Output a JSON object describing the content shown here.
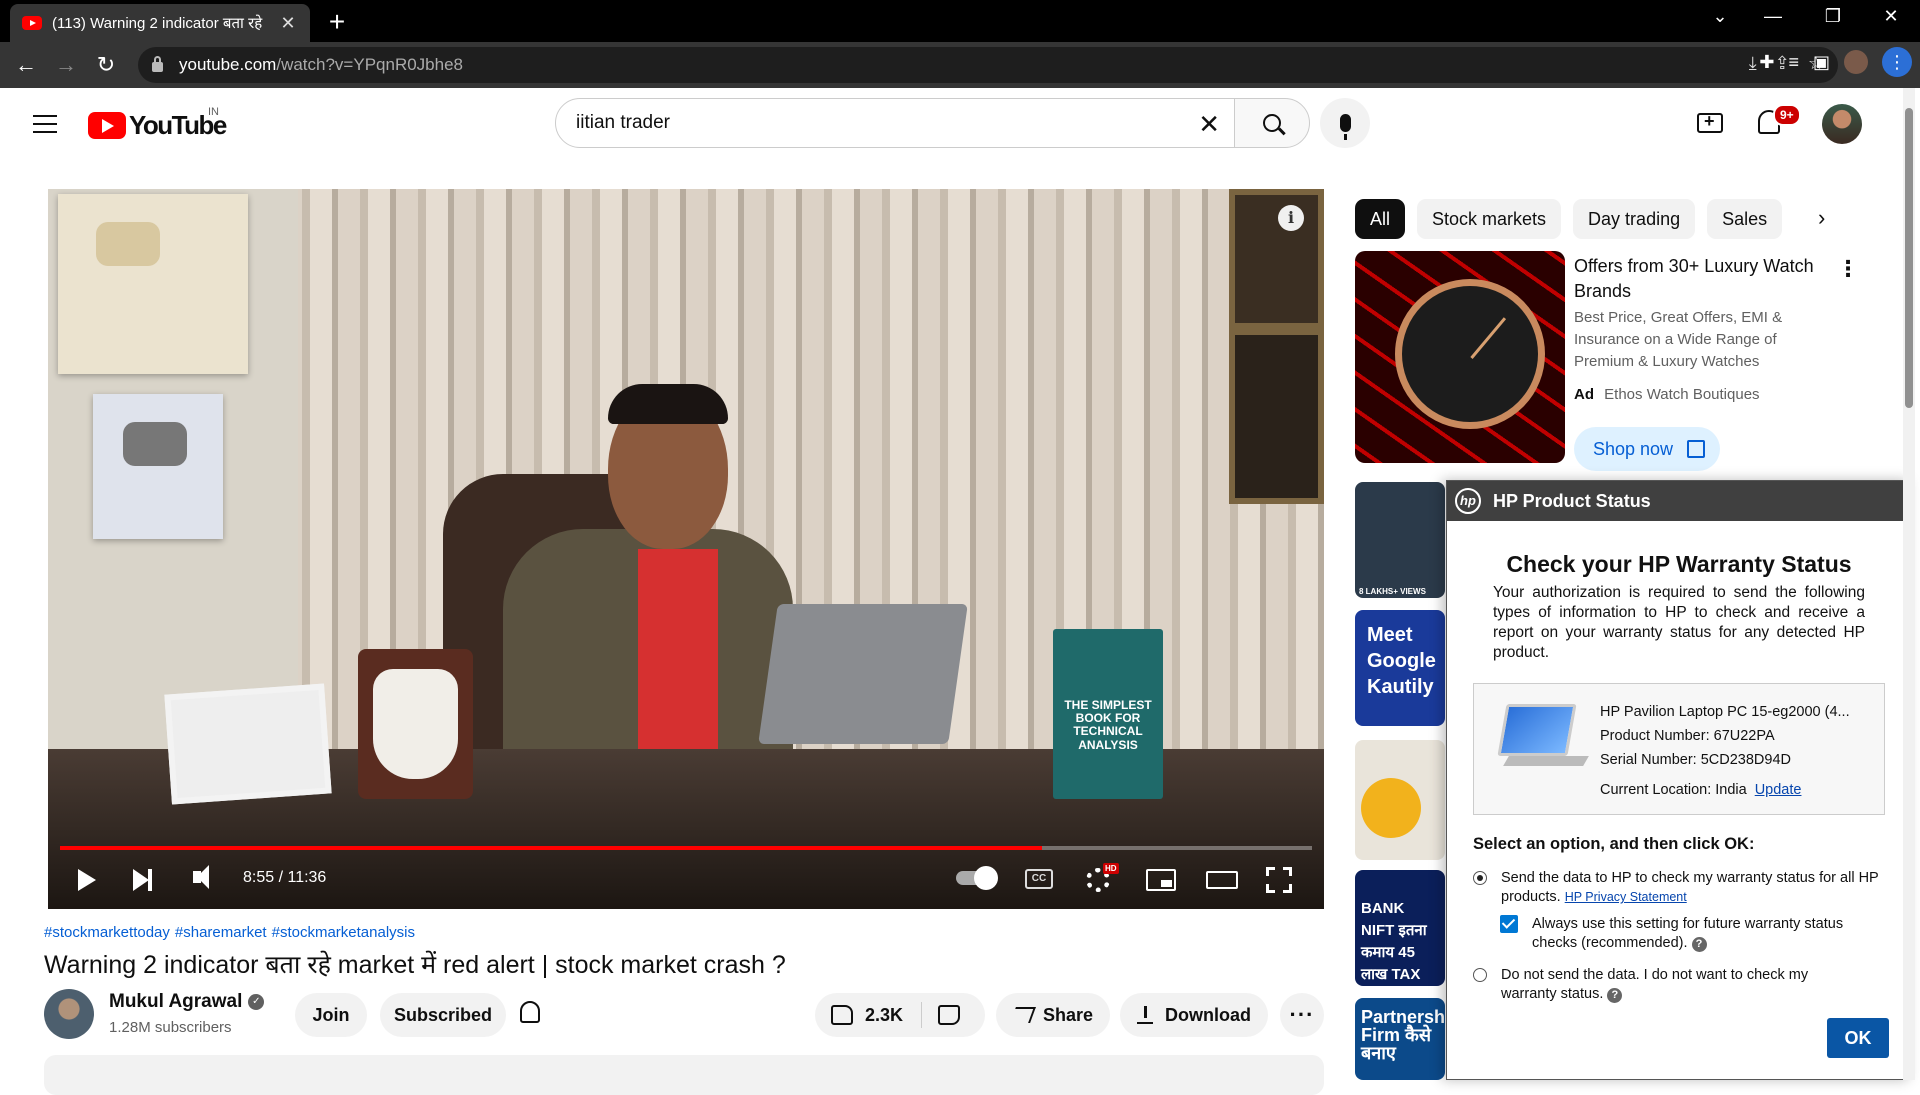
{
  "browser": {
    "tab_title": "(113) Warning 2 indicator बता रहे",
    "tab_close": "✕",
    "new_tab": "+",
    "url_host": "youtube.com",
    "url_path": "/watch?v=YPqnR0Jbhe8",
    "win_controls": [
      "⌄",
      "—",
      "❐",
      "✕"
    ]
  },
  "header": {
    "logo_text": "YouTube",
    "country_code": "IN",
    "search_value": "iitian trader",
    "search_clear": "✕",
    "notification_count": "9+"
  },
  "player": {
    "progress_fraction": 0.784,
    "current_time": "8:55 / 11:36",
    "info_label": "i",
    "cc_label": "CC",
    "hd_label": "HD",
    "book_text": "THE SIMPLEST BOOK FOR TECHNICAL ANALYSIS"
  },
  "video": {
    "hashtags": [
      "#stockmarkettoday",
      "#sharemarket",
      "#stockmarketanalysis"
    ],
    "title": "Warning 2 indicator बता रहे market में red alert | stock market crash ?",
    "channel_name": "Mukul Agrawal",
    "verified_mark": "✓",
    "subscribers": "1.28M subscribers",
    "join_label": "Join",
    "subscribed_label": "Subscribed",
    "likes": "2.3K",
    "share_label": "Share",
    "download_label": "Download",
    "more_label": "···"
  },
  "sidebar": {
    "chips": [
      "All",
      "Stock markets",
      "Day trading",
      "Sales"
    ],
    "chip_next": "›",
    "ad": {
      "title": "Offers from 30+ Luxury Watch Brands",
      "description": "Best Price, Great Offers, EMI & Insurance on a Wide Range of Premium & Luxury Watches",
      "badge": "Ad",
      "advertiser": "Ethos Watch Boutiques",
      "cta": "Shop now",
      "menu": "⋮"
    },
    "rec_thumbs": [
      {
        "text": "8 LAKHS+ VIEWS",
        "bg": "#2b3a4a"
      },
      {
        "text": "Meet Google Kautily",
        "bg": "#1a3a9a"
      },
      {
        "text": "",
        "bg": "#e9e4da"
      },
      {
        "text": "BANK NIFT इतना कमाय 45 लाख TAX",
        "bg": "#0b1f5a"
      },
      {
        "text": "Partnersh Firm कैसे बनाए",
        "bg": "#0c4a8a"
      }
    ]
  },
  "hp_dialog": {
    "title": "HP Product Status",
    "logo": "hp",
    "heading": "Check your HP Warranty Status",
    "intro": "Your authorization is required to send the following types of information to HP to check and receive a report on your warranty status for any detected HP product.",
    "product_name": "HP Pavilion Laptop PC 15-eg2000 (4...",
    "product_number": "Product Number: 67U22PA",
    "serial_number": "Serial Number: 5CD238D94D",
    "location": "Current Location: India",
    "update_link": "Update",
    "select_prompt": "Select an option, and then click OK:",
    "option_send": "Send the data to HP to check my warranty status for all HP products.",
    "privacy_link": "HP Privacy Statement",
    "option_always": "Always use this setting for future warranty status checks (recommended).",
    "option_dont": "Do not send the data. I do not want to check my warranty status.",
    "help": "?",
    "ok_label": "OK"
  },
  "colors": {
    "youtube_red": "#ff0000",
    "link_blue": "#065fd4",
    "hp_ok_blue": "#0a56a5"
  }
}
